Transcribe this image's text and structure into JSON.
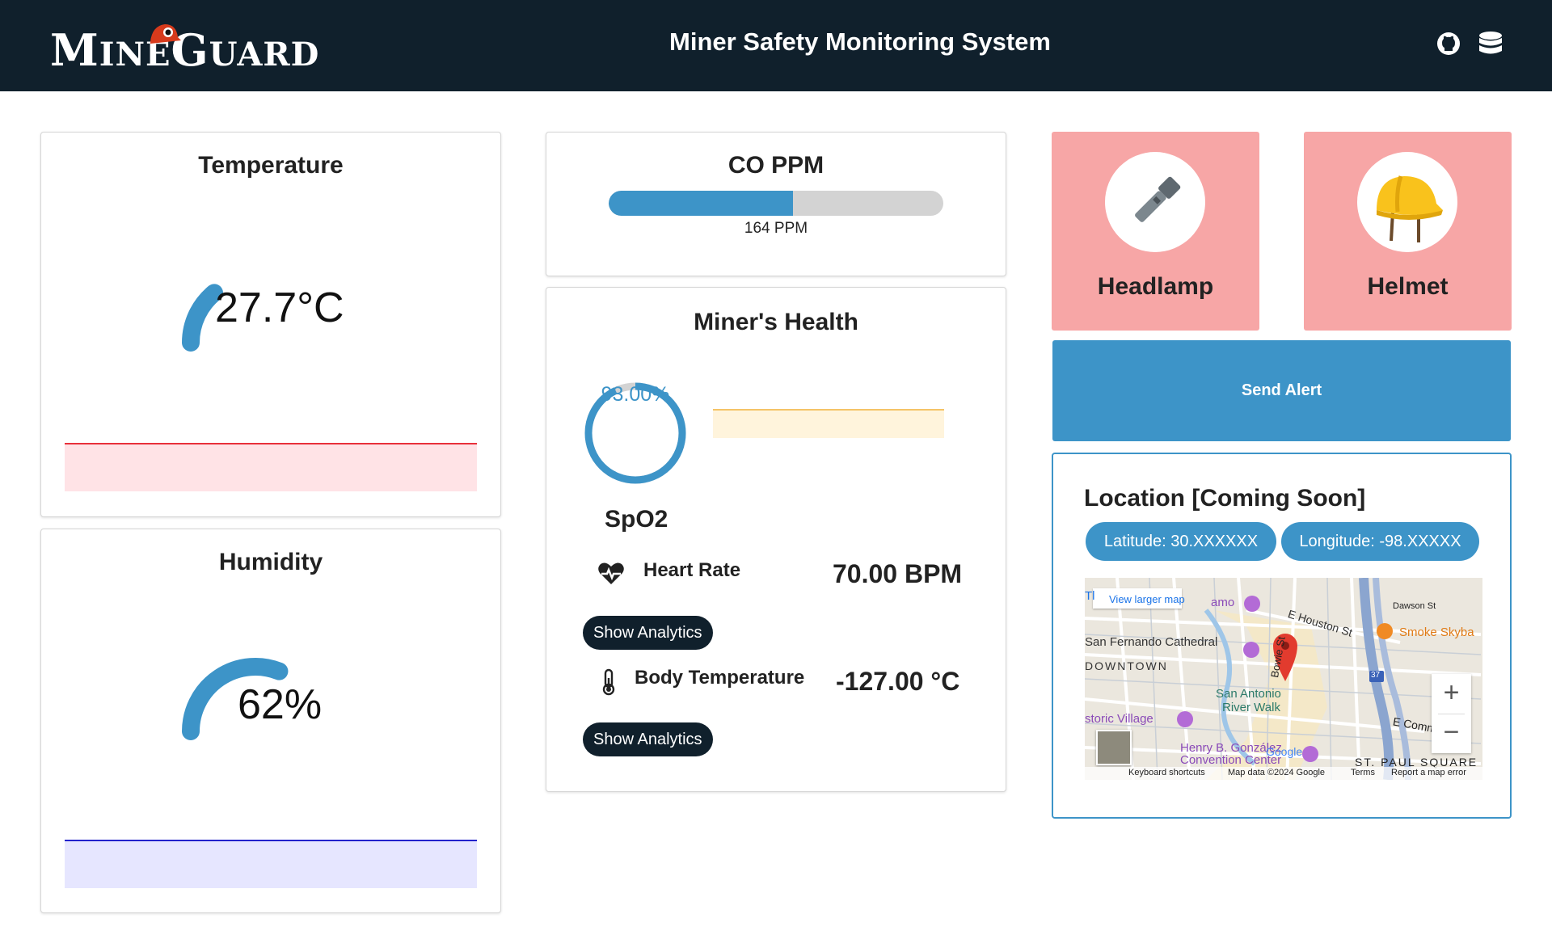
{
  "header": {
    "logo_first_big": "M",
    "logo_first_small": "INE",
    "logo_second_big": "G",
    "logo_second_small": "UARD",
    "title": "Miner Safety Monitoring System",
    "icons": [
      "github-icon",
      "database-icon"
    ]
  },
  "temperature": {
    "title": "Temperature",
    "value": "27.7°C",
    "gauge_fraction": 0.28,
    "color": "#3d94c8",
    "band_color": "#e8303a"
  },
  "humidity": {
    "title": "Humidity",
    "value": "62%",
    "gauge_fraction": 0.62,
    "color": "#3d94c8",
    "band_color": "#2222cc"
  },
  "co": {
    "title": "CO PPM",
    "value_label": "164 PPM",
    "bar_fraction": 0.55
  },
  "health": {
    "title": "Miner's Health",
    "spo2_value": "93.00%",
    "spo2_fraction": 0.93,
    "spo2_label": "SpO2",
    "heart_rate_label": "Heart Rate",
    "heart_rate_value": "70.00 BPM",
    "show_analytics_label": "Show Analytics",
    "body_temp_label": "Body Temperature",
    "body_temp_value": "-127.00 °C"
  },
  "devices": {
    "headlamp_label": "Headlamp",
    "helmet_label": "Helmet",
    "tile_color": "#f7a6a6"
  },
  "alert": {
    "label": "Send Alert"
  },
  "location": {
    "title": "Location [Coming Soon]",
    "latitude": "Latitude: 30.XXXXXX",
    "longitude": "Longitude: -98.XXXXX",
    "map": {
      "view_larger": "View larger map",
      "labels": {
        "cathedral": "San Fernando Cathedral",
        "downtown": "DOWNTOWN",
        "riverwalk1": "San Antonio",
        "riverwalk2": "River Walk",
        "village": "storic Village",
        "convention1": "Henry B. González",
        "convention2": "Convention Center",
        "houston": "E Houston St",
        "dawson": "Dawson St",
        "smoke": "Smoke Skyba",
        "bowie": "Bowie St",
        "commerce": "E Comm",
        "stpaul": "ST. PAUL SQUARE",
        "partial_a": "amo",
        "partial_t": "Tl",
        "shield": "37"
      },
      "footer": {
        "keyboard": "Keyboard shortcuts",
        "mapdata": "Map data ©2024 Google",
        "terms": "Terms",
        "report": "Report a map error"
      },
      "google": "Google",
      "zoom_in": "+",
      "zoom_out": "−"
    }
  }
}
